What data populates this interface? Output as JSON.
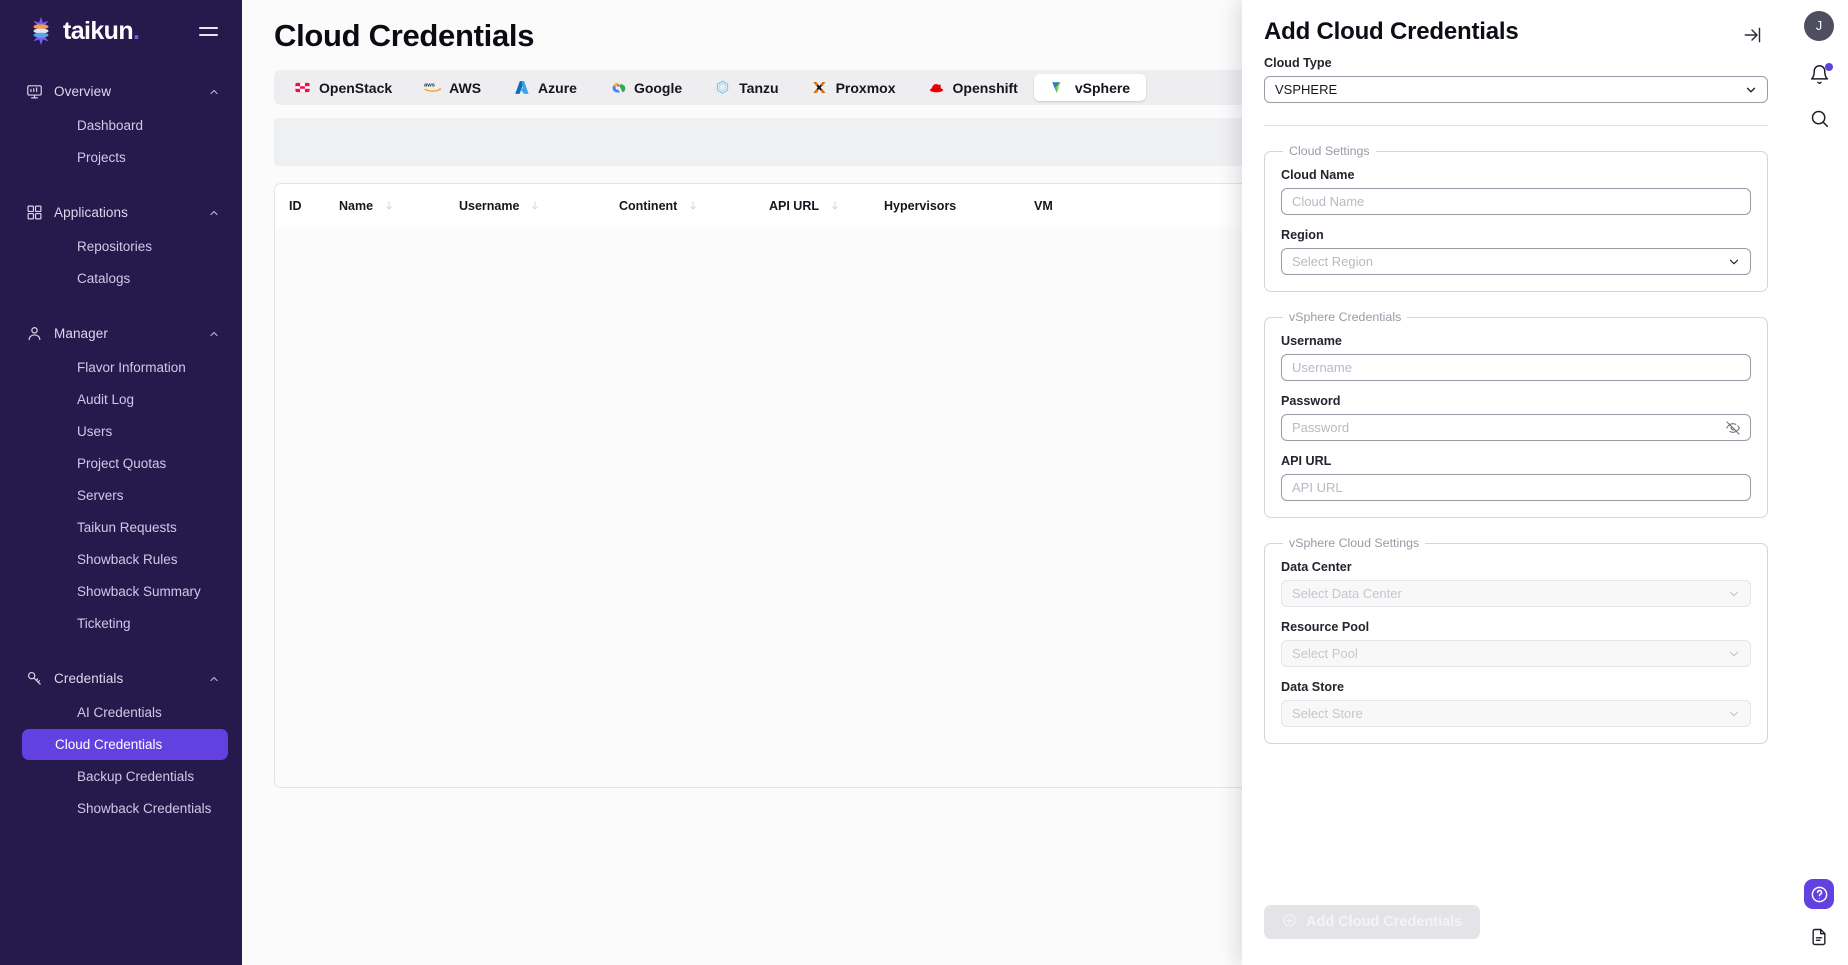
{
  "brand": {
    "name": "taikun",
    "dot": ".",
    "logo_icon": "taikun-logo-icon",
    "menu_icon": "hamburger-icon"
  },
  "sidebar": {
    "groups": [
      {
        "label": "Overview",
        "icon": "monitor-icon",
        "chevron": "chevron-up-icon",
        "items": [
          {
            "label": "Dashboard",
            "active": false
          },
          {
            "label": "Projects",
            "active": false
          }
        ]
      },
      {
        "label": "Applications",
        "icon": "grid-icon",
        "chevron": "chevron-up-icon",
        "items": [
          {
            "label": "Repositories",
            "active": false
          },
          {
            "label": "Catalogs",
            "active": false
          }
        ]
      },
      {
        "label": "Manager",
        "icon": "user-icon",
        "chevron": "chevron-up-icon",
        "items": [
          {
            "label": "Flavor Information",
            "active": false
          },
          {
            "label": "Audit Log",
            "active": false
          },
          {
            "label": "Users",
            "active": false
          },
          {
            "label": "Project Quotas",
            "active": false
          },
          {
            "label": "Servers",
            "active": false
          },
          {
            "label": "Taikun Requests",
            "active": false
          },
          {
            "label": "Showback Rules",
            "active": false
          },
          {
            "label": "Showback Summary",
            "active": false
          },
          {
            "label": "Ticketing",
            "active": false
          }
        ]
      },
      {
        "label": "Credentials",
        "icon": "key-icon",
        "chevron": "chevron-up-icon",
        "items": [
          {
            "label": "AI Credentials",
            "active": false
          },
          {
            "label": "Cloud Credentials",
            "active": true
          },
          {
            "label": "Backup Credentials",
            "active": false
          },
          {
            "label": "Showback Credentials",
            "active": false
          }
        ]
      }
    ]
  },
  "main": {
    "page_title": "Cloud Credentials",
    "tabs": [
      {
        "label": "OpenStack",
        "icon": "openstack-icon",
        "active": false
      },
      {
        "label": "AWS",
        "icon": "aws-icon",
        "active": false
      },
      {
        "label": "Azure",
        "icon": "azure-icon",
        "active": false
      },
      {
        "label": "Google",
        "icon": "google-cloud-icon",
        "active": false
      },
      {
        "label": "Tanzu",
        "icon": "tanzu-icon",
        "active": false
      },
      {
        "label": "Proxmox",
        "icon": "proxmox-icon",
        "active": false
      },
      {
        "label": "Openshift",
        "icon": "openshift-icon",
        "active": false
      },
      {
        "label": "vSphere",
        "icon": "vsphere-icon",
        "active": true
      }
    ],
    "table": {
      "columns": [
        {
          "label": "ID",
          "sortable": false
        },
        {
          "label": "Name",
          "sortable": true
        },
        {
          "label": "Username",
          "sortable": true
        },
        {
          "label": "Continent",
          "sortable": true
        },
        {
          "label": "API URL",
          "sortable": true
        },
        {
          "label": "Hypervisors",
          "sortable": false
        },
        {
          "label": "VM",
          "sortable": false
        }
      ],
      "rows": []
    }
  },
  "drawer": {
    "title": "Add Cloud Credentials",
    "collapse_icon": "collapse-right-icon",
    "cloud_type": {
      "label": "Cloud Type",
      "value": "VSPHERE",
      "chevron": "chevron-down-icon"
    },
    "cloud_settings": {
      "legend": "Cloud Settings",
      "fields": [
        {
          "label": "Cloud Name",
          "placeholder": "Cloud Name",
          "value": "",
          "type": "text",
          "disabled": false
        },
        {
          "label": "Region",
          "placeholder": "Select Region",
          "value": "",
          "type": "select",
          "disabled": false
        }
      ]
    },
    "vsphere_credentials": {
      "legend": "vSphere Credentials",
      "fields": [
        {
          "label": "Username",
          "placeholder": "Username",
          "value": "",
          "type": "text",
          "disabled": false
        },
        {
          "label": "Password",
          "placeholder": "Password",
          "value": "",
          "type": "password",
          "disabled": false,
          "icon": "eye-off-icon"
        },
        {
          "label": "API URL",
          "placeholder": "API URL",
          "value": "",
          "type": "text",
          "disabled": false
        }
      ]
    },
    "vsphere_cloud_settings": {
      "legend": "vSphere Cloud Settings",
      "fields": [
        {
          "label": "Data Center",
          "placeholder": "Select Data Center",
          "value": "",
          "type": "select",
          "disabled": true
        },
        {
          "label": "Resource Pool",
          "placeholder": "Select Pool",
          "value": "",
          "type": "select",
          "disabled": true
        },
        {
          "label": "Data Store",
          "placeholder": "Select Store",
          "value": "",
          "type": "select",
          "disabled": true
        }
      ]
    },
    "submit": {
      "label": "Add Cloud Credentials",
      "icon": "plus-circle-icon",
      "disabled": true
    }
  },
  "rail": {
    "avatar_initial": "J",
    "notifications_icon": "bell-icon",
    "has_notification": true,
    "search_icon": "search-icon",
    "help_icon": "help-circle-icon",
    "docs_icon": "document-icon"
  },
  "colors": {
    "sidebar_bg": "#261a4d",
    "accent": "#6340e0",
    "page_bg": "#fbfbfc",
    "tabstrip_bg": "#eeeef1"
  }
}
